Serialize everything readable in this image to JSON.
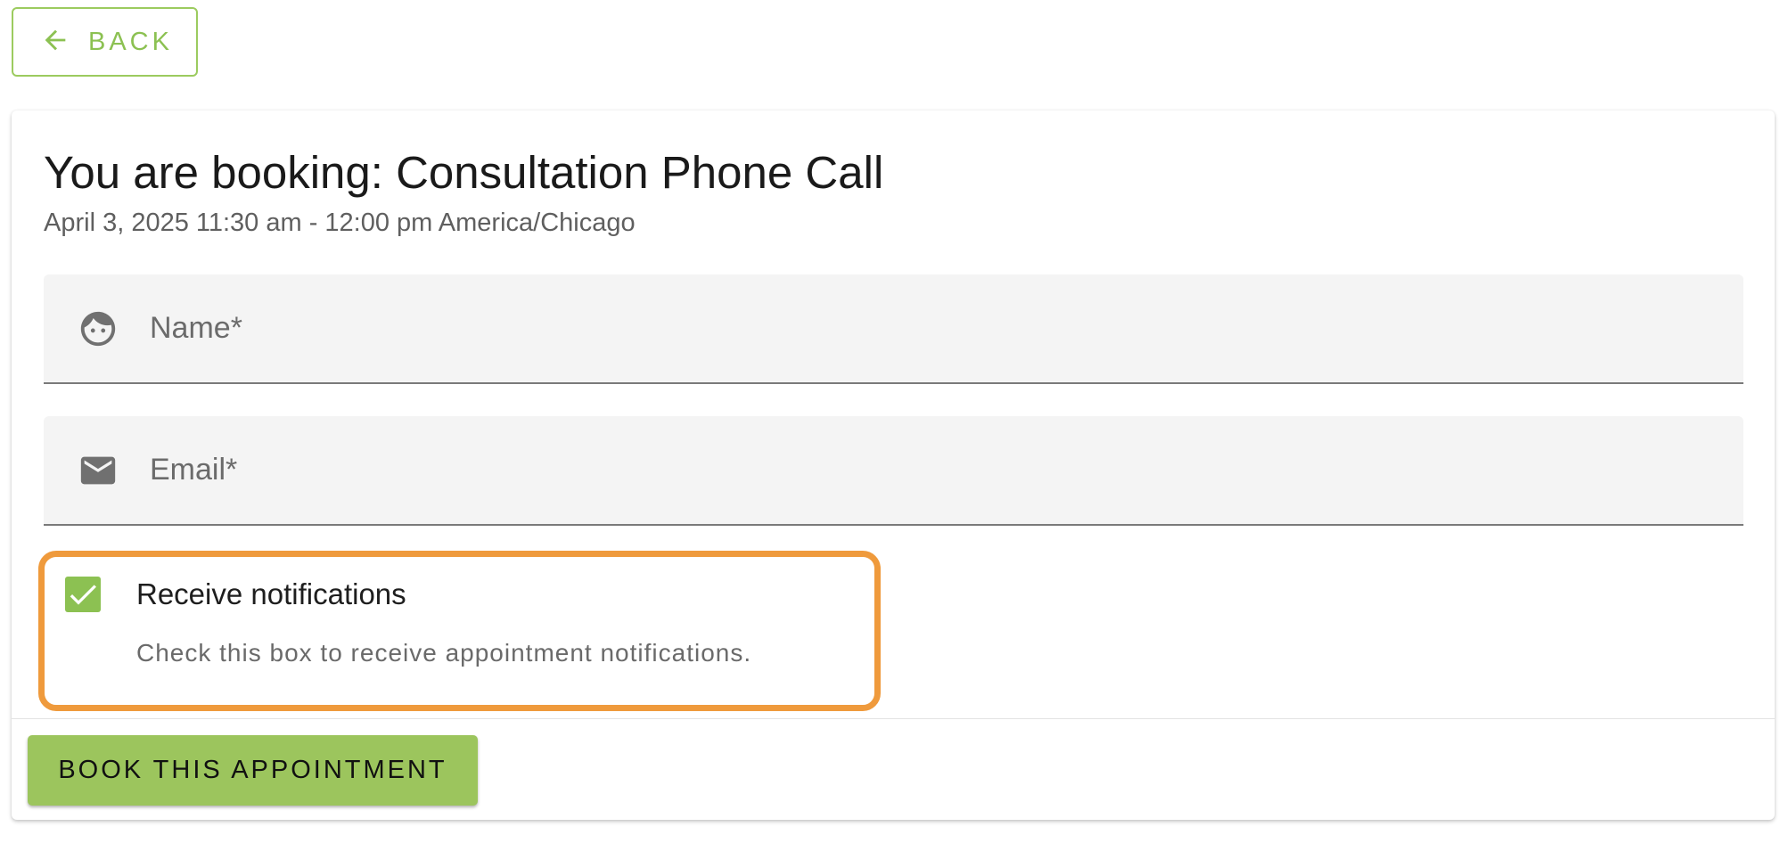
{
  "back": {
    "label": "BACK",
    "icon": "arrow-left-icon"
  },
  "booking": {
    "title": "You are booking: Consultation Phone Call",
    "datetime": "April 3, 2025 11:30 am - 12:00 pm America/Chicago"
  },
  "form": {
    "name": {
      "placeholder": "Name*",
      "value": "",
      "icon": "face-icon"
    },
    "email": {
      "placeholder": "Email*",
      "value": "",
      "icon": "mail-icon"
    },
    "notifications": {
      "label": "Receive notifications",
      "hint": "Check this box to receive appointment notifications.",
      "checked": true
    }
  },
  "actions": {
    "book_label": "BOOK THIS APPOINTMENT"
  },
  "colors": {
    "accent": "#8cc152",
    "button_bg": "#9cc55d",
    "highlight": "#ef9a3c"
  }
}
